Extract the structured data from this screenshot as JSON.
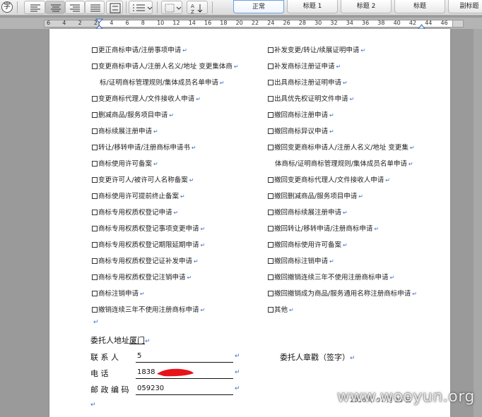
{
  "toolbar": {
    "icons": [
      "char-format-icon",
      "align-left-icon",
      "align-center-icon",
      "align-right-icon",
      "align-justify-icon",
      "line-spacing-icon",
      "list-icon",
      "border-icon",
      "sort-icon"
    ],
    "styles": [
      {
        "label": "正常",
        "active": true
      },
      {
        "label": "标题 1",
        "active": false
      },
      {
        "label": "标题 2",
        "active": false
      },
      {
        "label": "标题",
        "active": false
      },
      {
        "label": "副标题",
        "active": false
      }
    ],
    "char_icon_text": "字"
  },
  "ruler": {
    "numbers": [
      "6",
      "4",
      "2",
      "2",
      "4",
      "6",
      "8",
      "10",
      "12",
      "14",
      "16",
      "18",
      "20",
      "22",
      "24",
      "26",
      "28",
      "30",
      "32",
      "34",
      "36",
      "38",
      "40",
      "42",
      "44",
      "46"
    ]
  },
  "document": {
    "left_items": [
      "更正商标申请/注册事项申请",
      "变更商标申请人/注册人名义/地址 变更集体商",
      "标/证明商标管理规则/集体成员名单申请",
      "变更商标代理人/文件接收人申请",
      "删减商品/服务项目申请",
      "商标续展注册申请",
      "转让/移转申请/注册商标申请书",
      "商标使用许可备案",
      "变更许可人/被许可人名称备案",
      "商标使用许可提前终止备案",
      "商标专用权质权登记申请",
      "商标专用权质权登记事项变更申请",
      "商标专用权质权登记期限延期申请",
      "商标专用权质权登记证补发申请",
      "商标专用权质权登记注销申请",
      "商标注销申请",
      "撤销连续三年不使用注册商标申请"
    ],
    "left_has_box": [
      true,
      true,
      false,
      true,
      true,
      true,
      true,
      true,
      true,
      true,
      true,
      true,
      true,
      true,
      true,
      true,
      true
    ],
    "right_items": [
      "补发变更/转让/续展证明申请",
      "补发商标注册证申请",
      "出具商标注册证明申请",
      "出具优先权证明文件申请",
      "撤回商标注册申请",
      "撤回商标异议申请",
      "撤回变更商标申请人/注册人名义/地址 变更集",
      "体商标/证明商标管理规则/集体成员名单申请",
      "撤回变更商标代理人/文件接收人申请",
      "撤回删减商品/服务项目申请",
      "撤回商标续展注册申请",
      "撤回转让/移转申请/注册商标申请",
      "撤回商标使用许可备案",
      "撤回商标注销申请",
      "撤回撤销连续三年不使用注册商标申请",
      "撤回撤销成为商品/服务通用名称注册商标申请",
      "其他"
    ],
    "right_has_box": [
      true,
      true,
      true,
      true,
      true,
      true,
      true,
      false,
      true,
      true,
      true,
      true,
      true,
      true,
      true,
      true,
      true
    ],
    "address_label": "委托人地址",
    "address_value": "厦门",
    "contact_label": "联  系  人",
    "contact_value": "5",
    "phone_label": "电        话",
    "phone_value": "1838",
    "postcode_label": "邮 政 编 码",
    "postcode_value": "059230",
    "seal_label": "委托人章戳（签字）",
    "date_value": "2016 年 07 月 25 日"
  },
  "watermark": "www.wooyun.org",
  "colors": {
    "paragraph_mark": "#3b6fc8",
    "redaction": "#e8121b",
    "active_style_border": "#6d9fdc"
  }
}
